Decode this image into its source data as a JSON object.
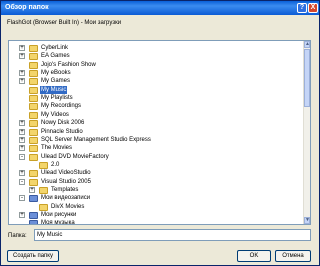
{
  "window": {
    "title": "Обзор папок",
    "help_symbol": "?",
    "close_symbol": "X"
  },
  "description": "FlashGot (Browser Built In) - Мои загрузки",
  "tree": {
    "items": [
      {
        "label": "CyberLink",
        "expander": "+",
        "icon": "folder-icon"
      },
      {
        "label": "EA Games",
        "expander": "+",
        "icon": "folder-icon"
      },
      {
        "label": "Jojo's Fashion Show",
        "expander": "",
        "icon": "folder-icon"
      },
      {
        "label": "My eBooks",
        "expander": "+",
        "icon": "folder-icon"
      },
      {
        "label": "My Games",
        "expander": "+",
        "icon": "folder-icon"
      },
      {
        "label": "My Music",
        "expander": "",
        "icon": "folder-icon",
        "selected": true
      },
      {
        "label": "My Playlists",
        "expander": "",
        "icon": "folder-icon"
      },
      {
        "label": "My Recordings",
        "expander": "",
        "icon": "folder-icon"
      },
      {
        "label": "My Videos",
        "expander": "",
        "icon": "folder-icon"
      },
      {
        "label": "Nowy Disk 2006",
        "expander": "+",
        "icon": "folder-icon"
      },
      {
        "label": "Pinnacle Studio",
        "expander": "+",
        "icon": "folder-icon"
      },
      {
        "label": "SQL Server Management Studio Express",
        "expander": "+",
        "icon": "folder-icon"
      },
      {
        "label": "The Movies",
        "expander": "+",
        "icon": "folder-icon"
      },
      {
        "label": "Ulead DVD MovieFactory",
        "expander": "-",
        "icon": "folder-icon"
      },
      {
        "label": "2.0",
        "expander": "",
        "icon": "folder-icon",
        "indent": 1
      },
      {
        "label": "Ulead VideoStudio",
        "expander": "+",
        "icon": "folder-icon"
      },
      {
        "label": "Visual Studio 2005",
        "expander": "-",
        "icon": "folder-icon"
      },
      {
        "label": "Templates",
        "expander": "+",
        "icon": "folder-icon",
        "indent": 1
      },
      {
        "label": "Мои видеозаписи",
        "expander": "-",
        "icon": "video-folder-icon"
      },
      {
        "label": "DivX Movies",
        "expander": "",
        "icon": "folder-icon",
        "indent": 1
      },
      {
        "label": "Мои рисунки",
        "expander": "+",
        "icon": "pictures-folder-icon"
      },
      {
        "label": "Моя музыка",
        "expander": "",
        "icon": "music-folder-icon"
      }
    ]
  },
  "path": {
    "label": "Папка:",
    "value": "My Music"
  },
  "buttons": {
    "new_folder": "Создать папку",
    "ok": "OK",
    "cancel": "Отмена"
  },
  "scrollbar": {
    "up_symbol": "▲",
    "down_symbol": "▼"
  }
}
